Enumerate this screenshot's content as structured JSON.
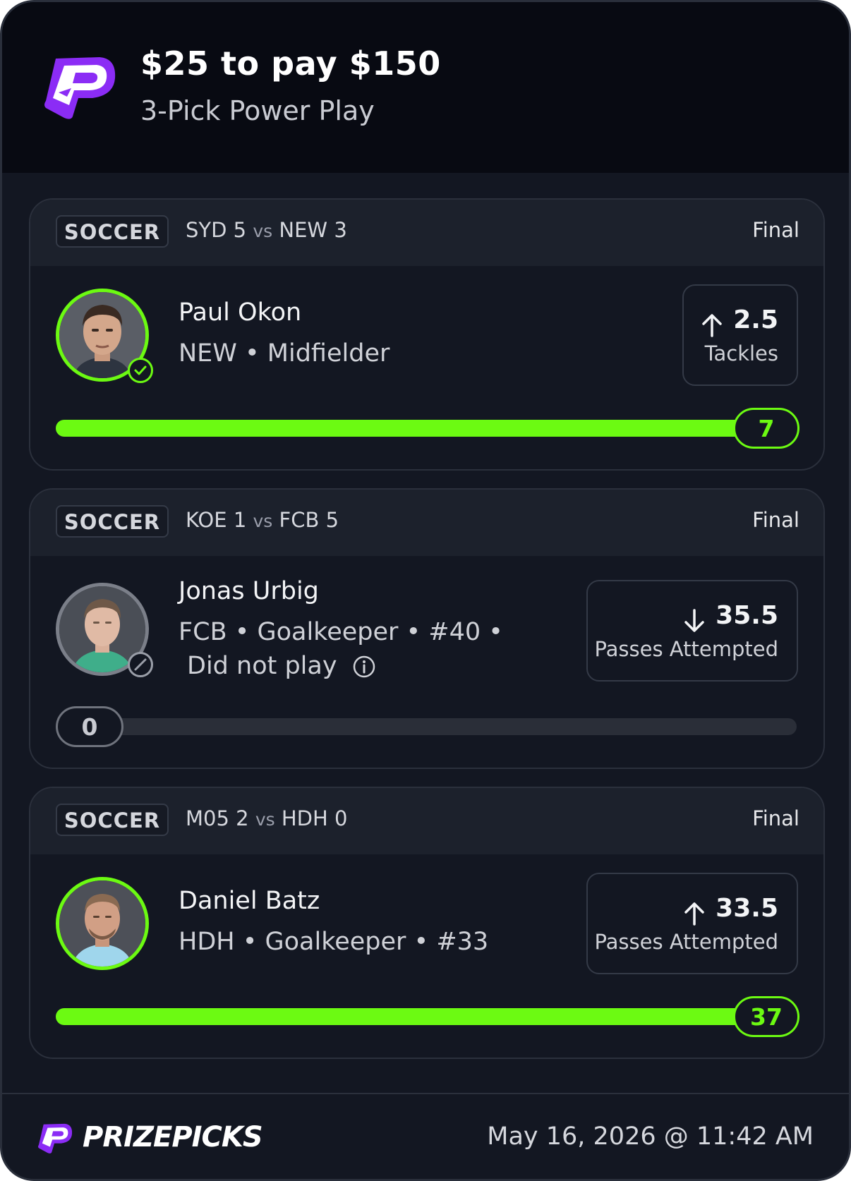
{
  "header": {
    "title": "$25 to pay $150",
    "subtitle": "3-Pick Power Play"
  },
  "picks": [
    {
      "sport": "SOCCER",
      "team1": "SYD",
      "score1": "5",
      "vs": "vs",
      "team2": "NEW",
      "score2": "3",
      "status": "Final",
      "player": "Paul Okon",
      "meta": "NEW • Midfielder",
      "direction": "more",
      "line": "2.5",
      "stat": "Tackles",
      "actual": "7",
      "progress": 1.0,
      "result": "hit"
    },
    {
      "sport": "SOCCER",
      "team1": "KOE",
      "score1": "1",
      "vs": "vs",
      "team2": "FCB",
      "score2": "5",
      "status": "Final",
      "player": "Jonas Urbig",
      "meta": "FCB • Goalkeeper • #40 •",
      "meta2": "Did not play",
      "direction": "less",
      "line": "35.5",
      "stat": "Passes Attempted",
      "actual": "0",
      "progress": 0.0,
      "result": "dnp"
    },
    {
      "sport": "SOCCER",
      "team1": "M05",
      "score1": "2",
      "vs": "vs",
      "team2": "HDH",
      "score2": "0",
      "status": "Final",
      "player": "Daniel Batz",
      "meta": "HDH • Goalkeeper • #33",
      "direction": "more",
      "line": "33.5",
      "stat": "Passes Attempted",
      "actual": "37",
      "progress": 1.0,
      "result": "hit"
    }
  ],
  "footer": {
    "brand": "PRIZEPICKS",
    "datetime": "May 16, 2026 @ 11:42 AM"
  },
  "colors": {
    "accent_green": "#6cfa12",
    "brand_purple": "#8b2cf5",
    "background": "#131722"
  },
  "icons": {
    "logo": "prizepicks-logo-icon",
    "up": "arrow-up-icon",
    "down": "arrow-down-icon",
    "check": "check-circle-icon",
    "dnp": "prohibited-icon",
    "info": "info-icon"
  }
}
